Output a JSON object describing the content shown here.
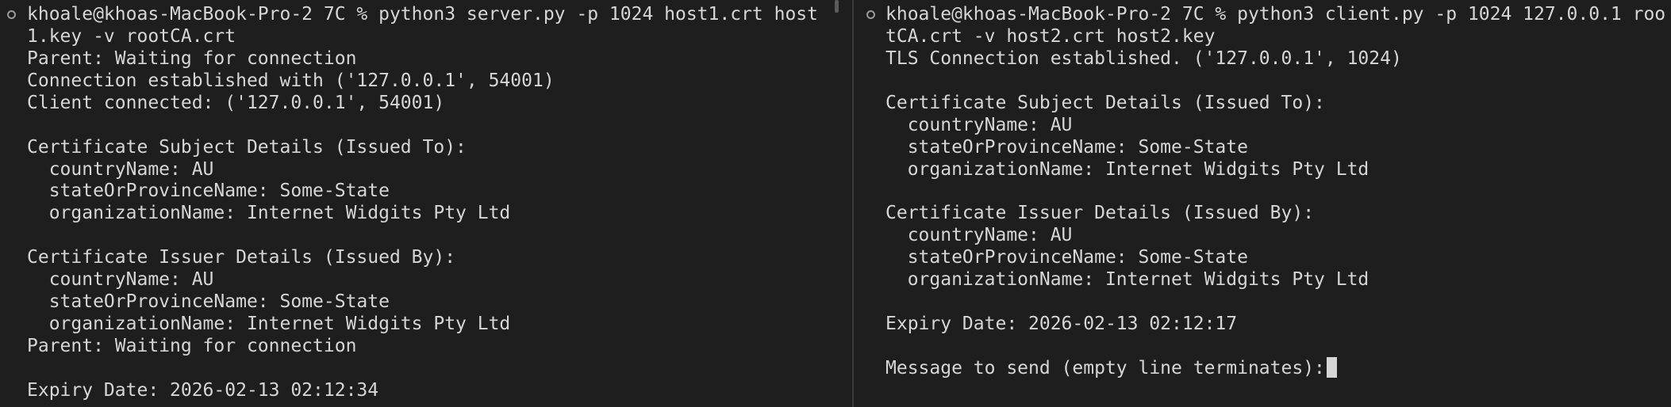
{
  "left_terminal": {
    "command_line_1": "khoale@khoas-MacBook-Pro-2 7C % python3 server.py -p 1024 host1.crt host",
    "command_line_2": "1.key -v rootCA.crt",
    "output": [
      "Parent: Waiting for connection",
      "Connection established with ('127.0.0.1', 54001)",
      "Client connected: ('127.0.0.1', 54001)",
      "",
      "Certificate Subject Details (Issued To):",
      "  countryName: AU",
      "  stateOrProvinceName: Some-State",
      "  organizationName: Internet Widgits Pty Ltd",
      "",
      "Certificate Issuer Details (Issued By):",
      "  countryName: AU",
      "  stateOrProvinceName: Some-State",
      "  organizationName: Internet Widgits Pty Ltd",
      "Parent: Waiting for connection",
      "",
      "Expiry Date: 2026-02-13 02:12:34"
    ]
  },
  "right_terminal": {
    "command_line_1": "khoale@khoas-MacBook-Pro-2 7C % python3 client.py -p 1024 127.0.0.1 roo",
    "command_line_2": "tCA.crt -v host2.crt host2.key",
    "output": [
      "TLS Connection established. ('127.0.0.1', 1024)",
      "",
      "Certificate Subject Details (Issued To):",
      "  countryName: AU",
      "  stateOrProvinceName: Some-State",
      "  organizationName: Internet Widgits Pty Ltd",
      "",
      "Certificate Issuer Details (Issued By):",
      "  countryName: AU",
      "  stateOrProvinceName: Some-State",
      "  organizationName: Internet Widgits Pty Ltd",
      "",
      "Expiry Date: 2026-02-13 02:12:17",
      "",
      "Message to send (empty line terminates):"
    ]
  },
  "colors": {
    "background": "#1e1e1e",
    "text": "#d6d6d6",
    "divider": "#3a3a3a",
    "prompt_mark": "#9a9a9a"
  },
  "icons": {
    "prompt_marker": "circle-outline-icon",
    "cursor": "block-cursor-icon"
  }
}
